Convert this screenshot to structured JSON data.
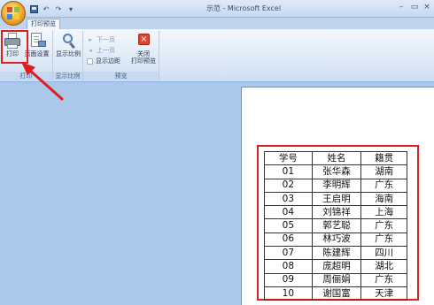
{
  "titlebar": {
    "document": "示范",
    "separator": " - ",
    "app": "Microsoft Excel"
  },
  "qat": {
    "undo_glyph": "↶",
    "redo_glyph": "↷",
    "more_glyph": "▾"
  },
  "window_controls": {
    "minimize": "–",
    "restore": "▭",
    "close": "×"
  },
  "tabs": [
    {
      "label": "打印预览"
    }
  ],
  "ribbon": {
    "groups": {
      "print": {
        "label": "打印",
        "print_button": "打印",
        "page_setup_button": "页面设置"
      },
      "zoom": {
        "label": "显示比例",
        "zoom_button": "显示比例"
      },
      "preview": {
        "label": "预览",
        "next_page": "下一页",
        "prev_page": "上一页",
        "show_margins": "显示边距",
        "close_line1": "关闭",
        "close_line2": "打印预览"
      }
    }
  },
  "icons": [
    "print-icon",
    "page-setup-icon",
    "zoom-icon",
    "next-page-icon",
    "prev-page-icon",
    "close-preview-icon",
    "save-icon"
  ],
  "highlight_color": "#e01e1e",
  "table": {
    "headers": [
      "学号",
      "姓名",
      "籍贯"
    ],
    "rows": [
      [
        "01",
        "张华森",
        "湖南"
      ],
      [
        "02",
        "李明辉",
        "广东"
      ],
      [
        "03",
        "王启明",
        "海南"
      ],
      [
        "04",
        "刘锦祥",
        "上海"
      ],
      [
        "05",
        "郭艺聪",
        "广东"
      ],
      [
        "06",
        "林巧波",
        "广东"
      ],
      [
        "07",
        "陈建辉",
        "四川"
      ],
      [
        "08",
        "庞超明",
        "湖北"
      ],
      [
        "09",
        "周俪娟",
        "广东"
      ],
      [
        "10",
        "谢国富",
        "天津"
      ]
    ]
  }
}
